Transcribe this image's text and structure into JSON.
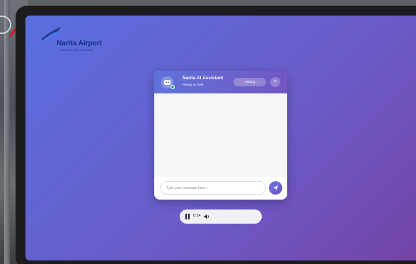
{
  "logo": {
    "name": "Narita Airport",
    "tagline": "Connecting Japan to the World"
  },
  "chat": {
    "title": "Narita AI Assistant",
    "status": "Ready to help",
    "waiting_label": "Waiting...",
    "close_label": "×",
    "input_placeholder": "Type your message here..."
  },
  "audio": {
    "time": "0:14"
  },
  "icons": {
    "avatar": "robot-icon",
    "close": "close-icon",
    "send": "send-icon",
    "pause": "pause-icon",
    "volume": "volume-icon"
  },
  "colors": {
    "gradient_start": "#5a6fe0",
    "gradient_end": "#7444a6",
    "online": "#22c55e",
    "brand_text": "#0f2f8a"
  }
}
